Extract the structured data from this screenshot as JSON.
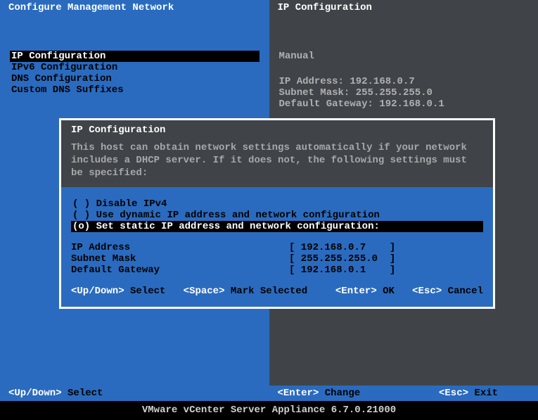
{
  "topbar": {
    "left_title": "Configure Management Network",
    "right_title": "IP Configuration"
  },
  "menu": {
    "items": [
      {
        "label": "IP Configuration",
        "selected": true
      },
      {
        "label": "IPv6 Configuration",
        "selected": false
      },
      {
        "label": "DNS Configuration",
        "selected": false
      },
      {
        "label": "Custom DNS Suffixes",
        "selected": false
      }
    ]
  },
  "info": {
    "mode": "Manual",
    "ip_label": "IP Address:",
    "ip_value": "192.168.0.7",
    "mask_label": "Subnet Mask:",
    "mask_value": "255.255.255.0",
    "gw_label": "Default Gateway:",
    "gw_value": "192.168.0.1"
  },
  "dialog": {
    "title": "IP Configuration",
    "description": "This host can obtain network settings automatically if your network includes a DHCP server. If it does not, the following settings must be specified:",
    "radios": [
      {
        "mark": "( )",
        "label": "Disable IPv4",
        "selected": false
      },
      {
        "mark": "( )",
        "label": "Use dynamic IP address and network configuration",
        "selected": false
      },
      {
        "mark": "(o)",
        "label": "Set static IP address and network configuration:",
        "selected": true
      }
    ],
    "fields": [
      {
        "label": "IP Address",
        "value": "[ 192.168.0.7    ]"
      },
      {
        "label": "Subnet Mask",
        "value": "[ 255.255.255.0  ]"
      },
      {
        "label": "Default Gateway",
        "value": "[ 192.168.0.1    ]"
      }
    ],
    "hints": {
      "updown_key": "<Up/Down>",
      "updown_act": "Select",
      "space_key": "<Space>",
      "space_act": "Mark Selected",
      "enter_key": "<Enter>",
      "enter_act": "OK",
      "esc_key": "<Esc>",
      "esc_act": "Cancel"
    }
  },
  "bottom": {
    "updown_key": "<Up/Down>",
    "updown_act": "Select",
    "enter_key": "<Enter>",
    "enter_act": "Change",
    "esc_key": "<Esc>",
    "esc_act": "Exit"
  },
  "footer": {
    "text": "VMware vCenter Server Appliance 6.7.0.21000"
  }
}
